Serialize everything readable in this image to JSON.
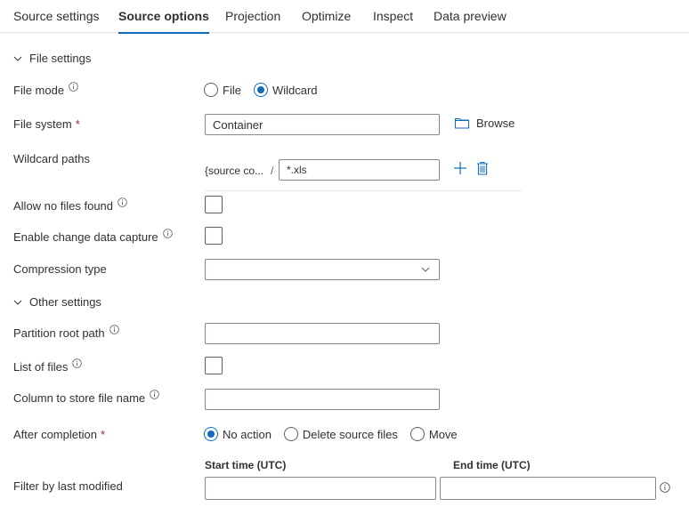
{
  "tabs": [
    {
      "label": "Source settings",
      "active": false
    },
    {
      "label": "Source options",
      "active": true
    },
    {
      "label": "Projection",
      "active": false
    },
    {
      "label": "Optimize",
      "active": false
    },
    {
      "label": "Inspect",
      "active": false
    },
    {
      "label": "Data preview",
      "active": false
    }
  ],
  "accent_color": "#0f6cbd",
  "file_settings": {
    "section_label": "File settings",
    "file_mode": {
      "label": "File mode",
      "options": [
        {
          "label": "File",
          "checked": false
        },
        {
          "label": "Wildcard",
          "checked": true
        }
      ]
    },
    "file_system": {
      "label": "File system",
      "required_mark": "*",
      "value": "Container",
      "browse_label": "Browse"
    },
    "wildcard_paths": {
      "label": "Wildcard paths",
      "prefix": "{source co...",
      "separator": "/",
      "value": "*.xls"
    },
    "allow_no_files_found": {
      "label": "Allow no files found",
      "checked": false
    },
    "enable_change_data_capture": {
      "label": "Enable change data capture",
      "checked": false
    },
    "compression_type": {
      "label": "Compression type",
      "value": ""
    }
  },
  "other_settings": {
    "section_label": "Other settings",
    "partition_root_path": {
      "label": "Partition root path",
      "value": ""
    },
    "list_of_files": {
      "label": "List of files",
      "checked": false
    },
    "column_to_store_file_name": {
      "label": "Column to store file name",
      "value": ""
    },
    "after_completion": {
      "label": "After completion",
      "required_mark": "*",
      "options": [
        {
          "label": "No action",
          "checked": true
        },
        {
          "label": "Delete source files",
          "checked": false
        },
        {
          "label": "Move",
          "checked": false
        }
      ]
    },
    "filter_by_last_modified": {
      "label": "Filter by last modified",
      "start_label": "Start time (UTC)",
      "start_value": "",
      "end_label": "End time (UTC)",
      "end_value": ""
    }
  },
  "icons": {
    "chevron": "chevron-down-icon",
    "info": "info-icon",
    "folder": "folder-icon",
    "add": "add-icon",
    "delete": "trash-icon"
  }
}
